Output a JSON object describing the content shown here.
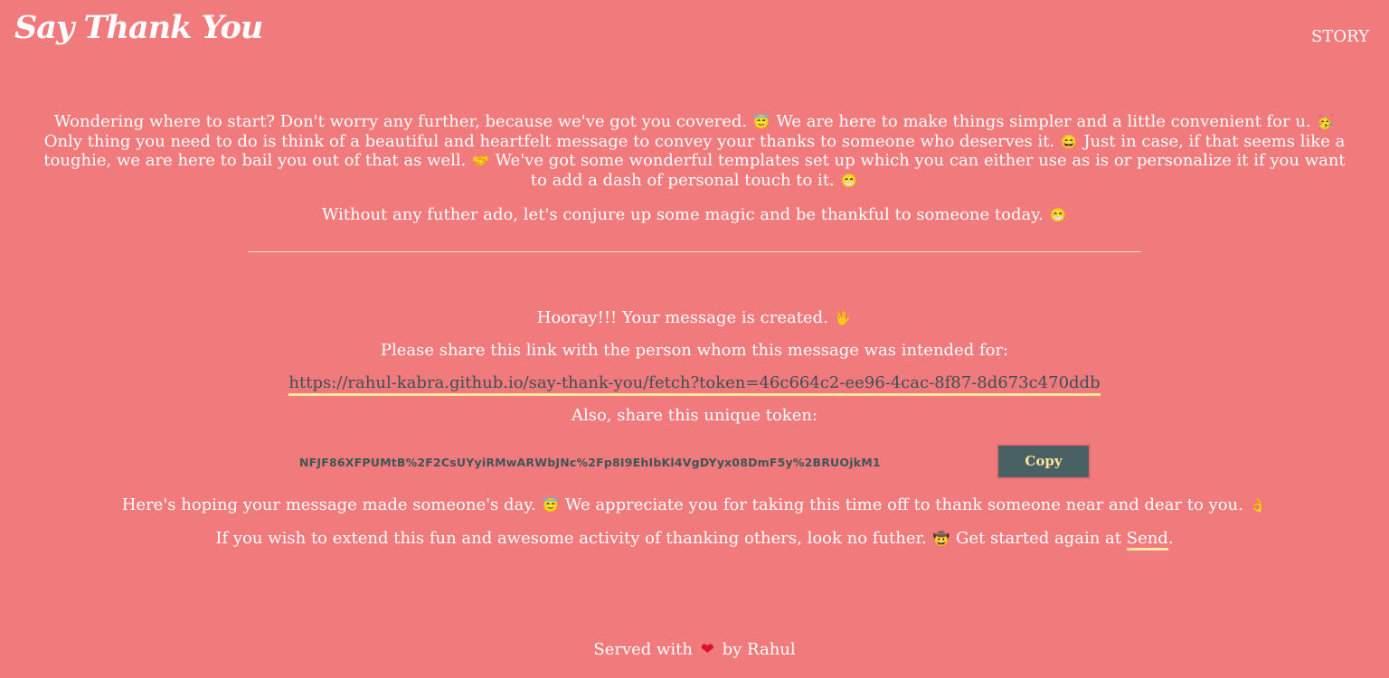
{
  "header": {
    "brand": "Say Thank You",
    "nav_story": "STORY"
  },
  "intro": {
    "s1": "Wondering where to start? Don't worry any further, because we've got you covered.",
    "s2": "We are here to make things simpler and a little convenient for u.",
    "s3": "Only thing you need to do is think of a beautiful and heartfelt message to convey your thanks to someone who deserves it.",
    "s4": "Just in case, if that seems like a toughie, we are here to bail you out of that as well.",
    "s5": "We've got some wonderful templates set up which you can either use as is or personalize it if you want to add a dash of personal touch to it.",
    "p2": "Without any futher ado, let's conjure up some magic and be thankful to someone today."
  },
  "result": {
    "hooray": "Hooray!!! Your message is created.",
    "share_prompt": "Please share this link with the person whom this message was intended for:",
    "link": "https://rahul-kabra.github.io/say-thank-you/fetch?token=46c664c2-ee96-4cac-8f87-8d673c470ddb",
    "token_prompt": "Also, share this unique token:",
    "token": "NFJF86XFPUMtB%2F2CsUYyiRMwARWbJNc%2Fp8I9EhIbKl4VgDYyx08DmF5y%2BRUOjkM1",
    "copy_label": "Copy",
    "hoping_a": "Here's hoping your message made someone's day.",
    "hoping_b": "We appreciate you for taking this time off to thank someone near and dear to you.",
    "extend_a": "If you wish to extend this fun and awesome activity of thanking others, look no futher.",
    "extend_b": "Get started again at",
    "send_label": "Send",
    "extend_end": "."
  },
  "emojis": {
    "e1": "😇",
    "e2": "🥳",
    "e3": "😄",
    "e4": "🤝",
    "e5": "😁",
    "e6": "😁",
    "e7": "🖖",
    "e8": "😇",
    "e9": "👌",
    "e10": "🤠"
  },
  "footer": {
    "before": "Served with",
    "heart": "❤",
    "after": "by Rahul"
  }
}
